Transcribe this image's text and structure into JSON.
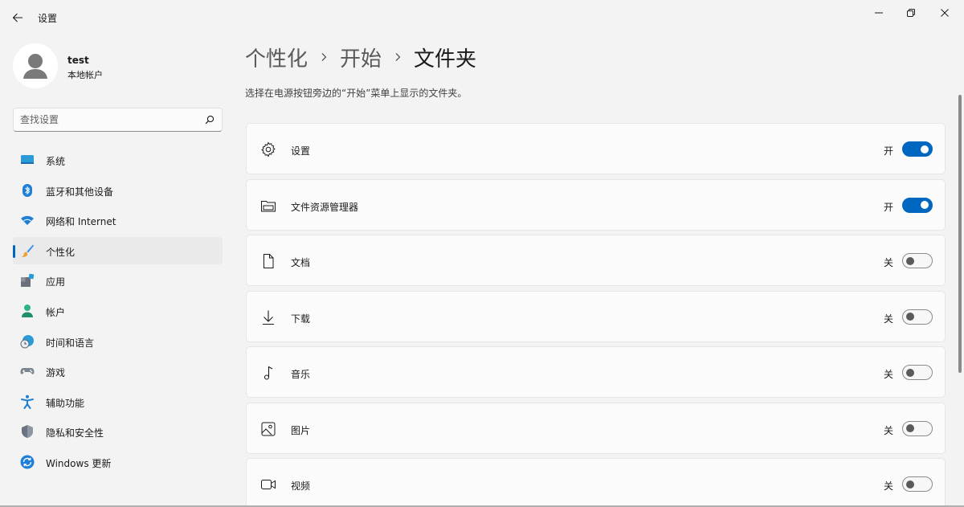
{
  "window": {
    "title": "设置"
  },
  "profile": {
    "name": "test",
    "account_type": "本地帐户"
  },
  "search": {
    "placeholder": "查找设置"
  },
  "sidebar": {
    "items": [
      {
        "label": "系统",
        "icon": "system-display-icon",
        "active": false
      },
      {
        "label": "蓝牙和其他设备",
        "icon": "bluetooth-icon",
        "active": false
      },
      {
        "label": "网络和 Internet",
        "icon": "wifi-icon",
        "active": false
      },
      {
        "label": "个性化",
        "icon": "paintbrush-icon",
        "active": true
      },
      {
        "label": "应用",
        "icon": "apps-icon",
        "active": false
      },
      {
        "label": "帐户",
        "icon": "account-icon",
        "active": false
      },
      {
        "label": "时间和语言",
        "icon": "globe-clock-icon",
        "active": false
      },
      {
        "label": "游戏",
        "icon": "gamepad-icon",
        "active": false
      },
      {
        "label": "辅助功能",
        "icon": "accessibility-icon",
        "active": false
      },
      {
        "label": "隐私和安全性",
        "icon": "shield-icon",
        "active": false
      },
      {
        "label": "Windows 更新",
        "icon": "update-icon",
        "active": false
      }
    ]
  },
  "breadcrumb": {
    "items": [
      "个性化",
      "开始",
      "文件夹"
    ]
  },
  "description": "选择在电源按钮旁边的“开始”菜单上显示的文件夹。",
  "folders": [
    {
      "label": "设置",
      "icon": "gear-icon",
      "state": "开",
      "on": true
    },
    {
      "label": "文件资源管理器",
      "icon": "file-explorer-icon",
      "state": "开",
      "on": true
    },
    {
      "label": "文档",
      "icon": "document-icon",
      "state": "关",
      "on": false
    },
    {
      "label": "下载",
      "icon": "download-icon",
      "state": "关",
      "on": false
    },
    {
      "label": "音乐",
      "icon": "music-note-icon",
      "state": "关",
      "on": false
    },
    {
      "label": "图片",
      "icon": "picture-icon",
      "state": "关",
      "on": false
    },
    {
      "label": "视频",
      "icon": "video-icon",
      "state": "关",
      "on": false
    }
  ],
  "colors": {
    "accent": "#0067c0",
    "background": "#f3f3f3",
    "card": "#fbfbfb"
  }
}
